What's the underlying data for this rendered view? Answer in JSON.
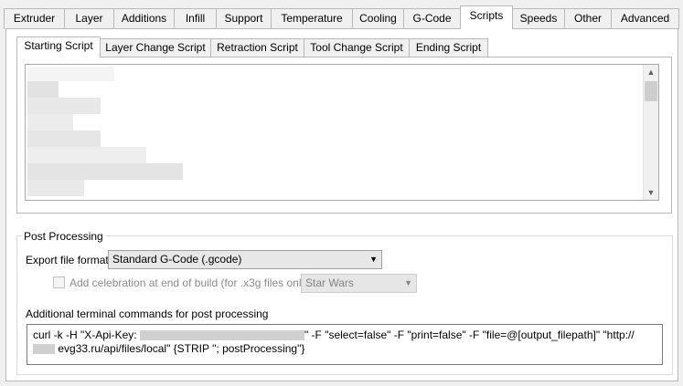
{
  "main_tabs": [
    "Extruder",
    "Layer",
    "Additions",
    "Infill",
    "Support",
    "Temperature",
    "Cooling",
    "G-Code",
    "Scripts",
    "Speeds",
    "Other",
    "Advanced"
  ],
  "active_main_tab": "Scripts",
  "script_tabs": [
    "Starting Script",
    "Layer Change Script",
    "Retraction Script",
    "Tool Change Script",
    "Ending Script"
  ],
  "active_script_tab": "Starting Script",
  "post_processing": {
    "title": "Post Processing",
    "export_label": "Export file format",
    "export_value": "Standard G-Code (.gcode)",
    "celebration_label": "Add celebration at end of build (for .x3g files only)",
    "celebration_checked": false,
    "celebration_song": "Star Wars",
    "terminal_label": "Additional terminal commands for post processing",
    "command_line1_start": "curl -k -H \"X-Api-Key:",
    "command_line1_end": "\" -F \"select=false\" -F \"print=false\" -F \"file=@[output_filepath]\" \"http://",
    "command_line2": "evg33.ru/api/files/local\" {STRIP \"; postProcessing\"}"
  },
  "icons": {
    "scroll_up": "scroll-up-arrow-icon",
    "scroll_down": "scroll-down-arrow-icon",
    "dropdown": "chevron-down-icon"
  }
}
